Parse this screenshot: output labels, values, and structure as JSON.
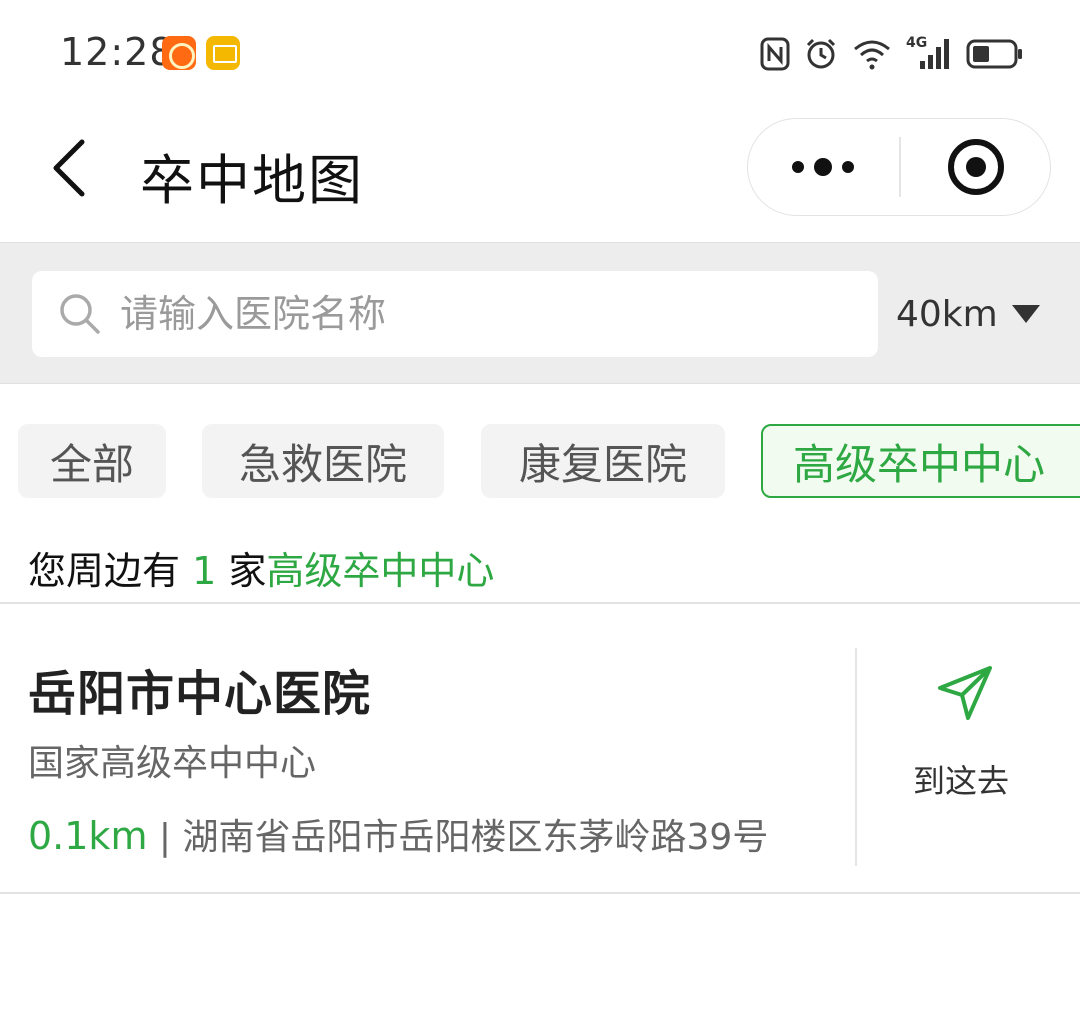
{
  "status_bar": {
    "time": "12:28",
    "network": "4G",
    "icons": [
      "taobao-app-icon",
      "mail-app-icon",
      "nfc-icon",
      "alarm-icon",
      "wifi-icon",
      "cellular-signal-icon",
      "battery-icon"
    ]
  },
  "header": {
    "title": "卒中地图",
    "back_icon": "chevron-left-icon",
    "more_icon": "more-dots-icon",
    "close_icon": "target-circle-icon"
  },
  "search": {
    "placeholder": "请输入医院名称",
    "value": "",
    "distance": "40km"
  },
  "tabs": [
    {
      "label": "全部",
      "active": false
    },
    {
      "label": "急救医院",
      "active": false
    },
    {
      "label": "康复医院",
      "active": false
    },
    {
      "label": "高级卒中中心",
      "active": true
    }
  ],
  "summary": {
    "prefix": "您周边有",
    "count": "1",
    "unit": "家",
    "category": "高级卒中中心"
  },
  "hospitals": [
    {
      "name": "岳阳市中心医院",
      "level": "国家高级卒中中心",
      "distance": "0.1km",
      "separator": "|",
      "address": "湖南省岳阳市岳阳楼区东茅岭路39号",
      "nav_label": "到这去"
    }
  ],
  "colors": {
    "accent_green": "#2ea843",
    "tab_bg": "#f3f3f3",
    "search_bg": "#ededed"
  }
}
